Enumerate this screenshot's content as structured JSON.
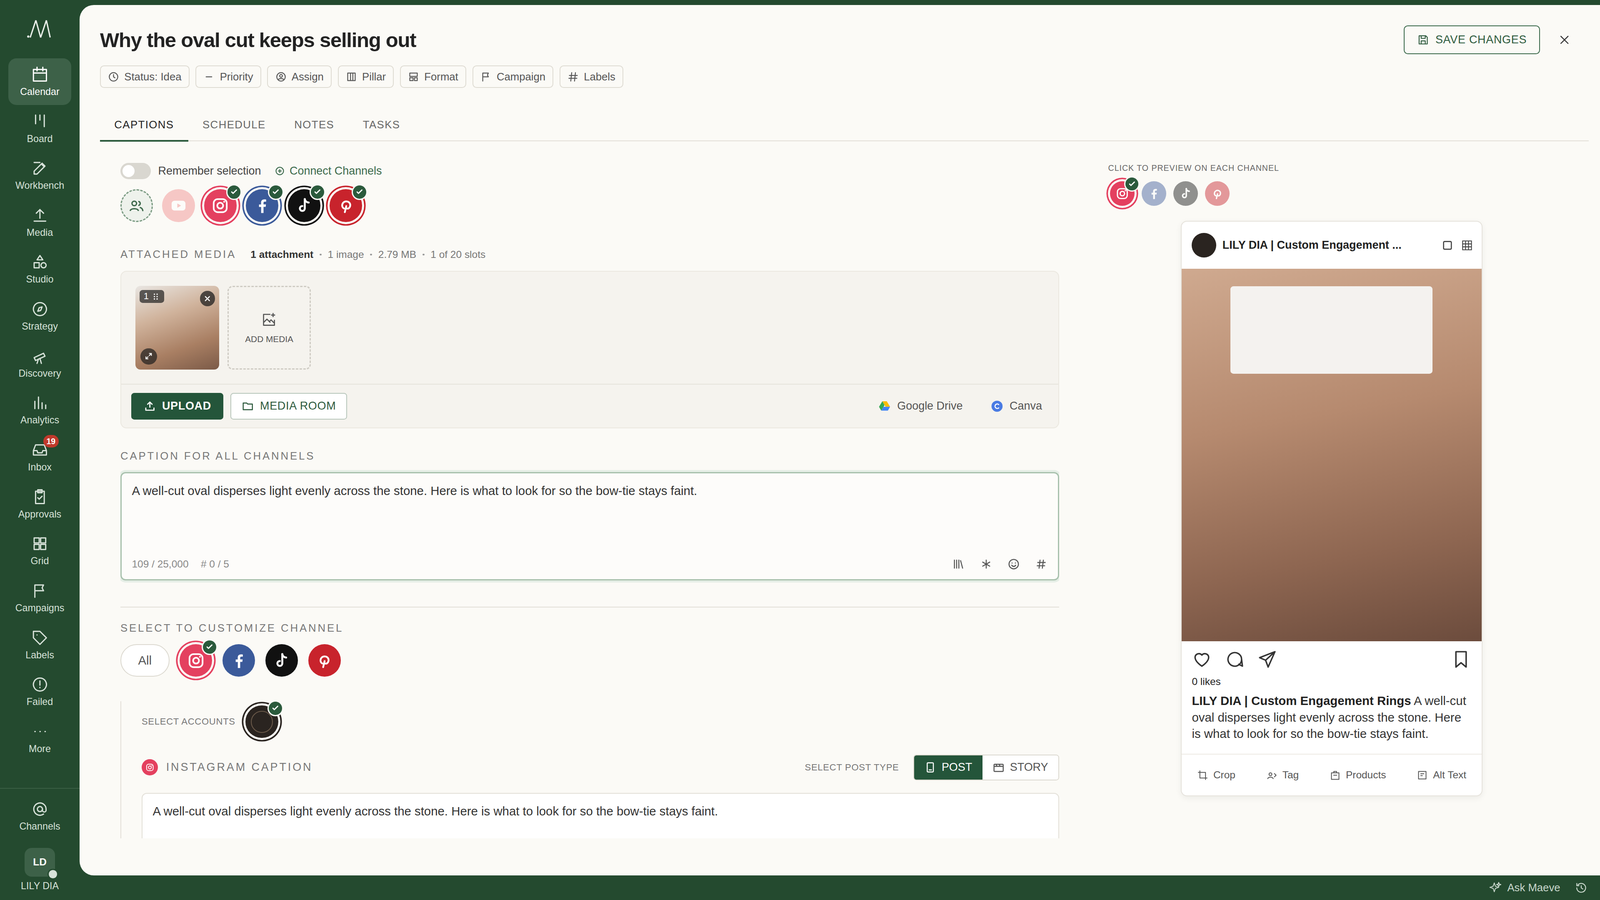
{
  "sidebar": {
    "items": [
      {
        "label": "Calendar",
        "selected": true
      },
      {
        "label": "Board",
        "selected": false
      },
      {
        "label": "Workbench",
        "selected": false
      },
      {
        "label": "Media",
        "selected": false
      },
      {
        "label": "Studio",
        "selected": false
      },
      {
        "label": "Strategy",
        "selected": false
      },
      {
        "label": "Discovery",
        "selected": false
      },
      {
        "label": "Analytics",
        "selected": false
      },
      {
        "label": "Inbox",
        "selected": false,
        "badge": "19"
      },
      {
        "label": "Approvals",
        "selected": false
      },
      {
        "label": "Grid",
        "selected": false
      },
      {
        "label": "Campaigns",
        "selected": false
      },
      {
        "label": "Labels",
        "selected": false
      },
      {
        "label": "Failed",
        "selected": false
      },
      {
        "label": "More",
        "selected": false
      }
    ],
    "footer": {
      "channels": "Channels",
      "avatar": "LD",
      "account": "LILY DIA"
    }
  },
  "header": {
    "title": "Why the oval cut keeps selling out",
    "chips": [
      "Status: Idea",
      "Priority",
      "Assign",
      "Pillar",
      "Format",
      "Campaign",
      "Labels"
    ],
    "save": "SAVE CHANGES"
  },
  "tabs": [
    {
      "label": "CAPTIONS",
      "selected": true
    },
    {
      "label": "SCHEDULE",
      "selected": false
    },
    {
      "label": "NOTES",
      "selected": false
    },
    {
      "label": "TASKS",
      "selected": false
    }
  ],
  "channels": {
    "remember": {
      "label": "Remember selection",
      "on": false
    },
    "connect": "Connect Channels",
    "items": [
      {
        "kind": "group",
        "selected": false,
        "color": "#eef2ec"
      },
      {
        "kind": "youtube",
        "selected": false,
        "color": "#f08a8a"
      },
      {
        "kind": "instagram",
        "selected": true,
        "color": "#e4405f"
      },
      {
        "kind": "facebook",
        "selected": true,
        "color": "#3b5a9a"
      },
      {
        "kind": "tiktok",
        "selected": true,
        "color": "#111111"
      },
      {
        "kind": "pinterest",
        "selected": true,
        "color": "#c8232c"
      }
    ]
  },
  "media": {
    "title": "ATTACHED MEDIA",
    "count": "1 attachment",
    "stats": [
      "1 image",
      "2.79 MB",
      "1 of 20 slots"
    ],
    "items": [
      {
        "index": "1"
      }
    ],
    "add": "ADD MEDIA",
    "upload": "UPLOAD",
    "media_room": "MEDIA ROOM",
    "sources": [
      "Google Drive",
      "Canva"
    ]
  },
  "caption": {
    "title": "CAPTION FOR ALL CHANNELS",
    "text": "A well-cut oval disperses light evenly across the stone. Here is what to look for so the bow-tie stays faint.",
    "count": "109 / 25,000",
    "hashtags": "# 0 / 5"
  },
  "customize": {
    "title": "SELECT TO CUSTOMIZE CHANNEL",
    "all": {
      "label": "All",
      "selected": false
    },
    "items": [
      {
        "kind": "instagram",
        "selected": true,
        "color": "#e4405f"
      },
      {
        "kind": "facebook",
        "selected": false,
        "color": "#3b5a9a"
      },
      {
        "kind": "tiktok",
        "selected": false,
        "color": "#111111"
      },
      {
        "kind": "pinterest",
        "selected": false,
        "color": "#c8232c"
      }
    ],
    "accounts_label": "SELECT ACCOUNTS",
    "accounts": [
      {
        "selected": true
      }
    ],
    "channel_caption_title": "INSTAGRAM CAPTION",
    "post_type_label": "SELECT POST TYPE",
    "post_types": [
      {
        "label": "POST",
        "selected": true
      },
      {
        "label": "STORY",
        "selected": false
      }
    ],
    "channel_caption_text": "A well-cut oval disperses light evenly across the stone. Here is what to look for so the bow-tie stays faint."
  },
  "preview": {
    "title": "CLICK TO PREVIEW ON EACH CHANNEL",
    "channels": [
      {
        "kind": "instagram",
        "selected": true,
        "color": "#e4405f"
      },
      {
        "kind": "facebook",
        "selected": false,
        "color": "#3b5a9a"
      },
      {
        "kind": "tiktok",
        "selected": false,
        "color": "#111111"
      },
      {
        "kind": "pinterest",
        "selected": false,
        "color": "#c8232c"
      }
    ],
    "account": "LILY DIA | Custom Engagement ...",
    "likes": "0 likes",
    "caption_account": "LILY DIA | Custom Engagement Rings",
    "caption_text": "A well-cut oval disperses light evenly across the stone. Here is what to look for so the bow-tie stays faint.",
    "tools": [
      "Crop",
      "Tag",
      "Products",
      "Alt Text"
    ]
  },
  "status_bar": {
    "assistant": "Ask Maeve"
  }
}
